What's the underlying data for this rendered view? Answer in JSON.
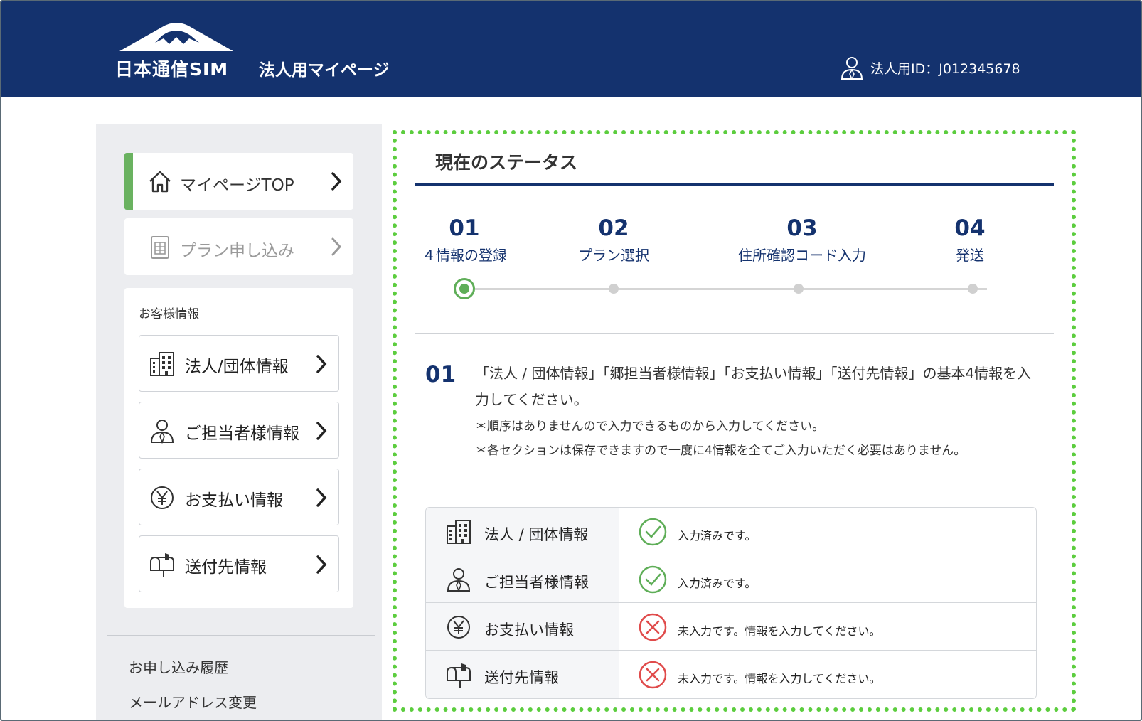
{
  "header": {
    "brand": "日本通信SIM",
    "site_title": "法人用マイページ",
    "user_id": "法人用ID：J012345678"
  },
  "sidebar": {
    "nav": [
      {
        "label": "マイページTOP",
        "icon": "home-icon",
        "active": true
      },
      {
        "label": "プラン申し込み",
        "icon": "sim-card-icon",
        "disabled": true
      }
    ],
    "customer_heading": "お客様情報",
    "customer_items": [
      {
        "label": "法人/団体情報",
        "icon": "building-icon"
      },
      {
        "label": "ご担当者様情報",
        "icon": "person-icon"
      },
      {
        "label": "お支払い情報",
        "icon": "yen-icon"
      },
      {
        "label": "送付先情報",
        "icon": "mailbox-icon"
      }
    ],
    "links": [
      "お申し込み履歴",
      "メールアドレス変更"
    ]
  },
  "main": {
    "title": "現在のステータス",
    "steps": [
      {
        "num": "01",
        "name": "４情報の登録"
      },
      {
        "num": "02",
        "name": "プラン選択"
      },
      {
        "num": "03",
        "name": "住所確認コード入力"
      },
      {
        "num": "04",
        "name": "発送"
      }
    ],
    "current_step": 1,
    "detail": {
      "num": "01",
      "instruction": "「法人 / 団体情報」「郷担当者様情報」「お支払い情報」「送付先情報」の基本4情報を入力してください。",
      "notes": [
        "＊順序はありませんので入力できるものから入力してください。",
        "＊各セクションは保存できますので一度に4情報を全てご入力いただく必要はありません。"
      ]
    },
    "status_rows": [
      {
        "label": "法人 / 団体情報",
        "icon": "building-icon",
        "status": "done",
        "text": "入力済みです。"
      },
      {
        "label": "ご担当者様情報",
        "icon": "person-icon",
        "status": "done",
        "text": "入力済みです。"
      },
      {
        "label": "お支払い情報",
        "icon": "yen-icon",
        "status": "missing",
        "text": "未入力です。情報を入力してください。"
      },
      {
        "label": "送付先情報",
        "icon": "mailbox-icon",
        "status": "missing",
        "text": "未入力です。情報を入力してください。"
      }
    ]
  },
  "colors": {
    "header_bg": "#14326e",
    "accent_green": "#6ab260",
    "done_green": "#5fae58",
    "error_red": "#e04b4b",
    "dotted_border": "#5ccd3e"
  }
}
